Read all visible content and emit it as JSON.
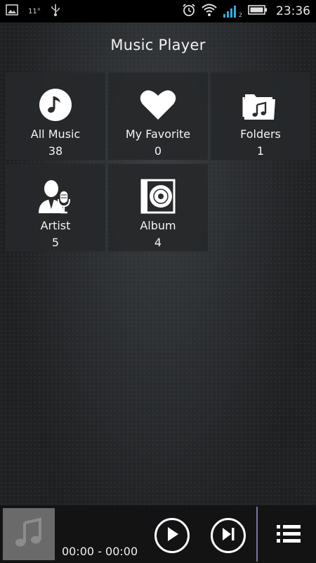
{
  "status_bar": {
    "temperature": "11°",
    "time": "23:36",
    "signal_tag": "2",
    "icons": [
      "gallery-icon",
      "usb-icon",
      "alarm-icon",
      "wifi-icon",
      "signal-icon",
      "battery-icon"
    ]
  },
  "header": {
    "title": "Music Player"
  },
  "tiles": [
    {
      "label": "All Music",
      "count": "38",
      "icon": "music-note-icon"
    },
    {
      "label": "My Favorite",
      "count": "0",
      "icon": "heart-icon"
    },
    {
      "label": "Folders",
      "count": "1",
      "icon": "folder-music-icon"
    },
    {
      "label": "Artist",
      "count": "5",
      "icon": "artist-microphone-icon"
    },
    {
      "label": "Album",
      "count": "4",
      "icon": "album-disc-icon"
    }
  ],
  "player": {
    "time_display": "00:00 - 00:00",
    "icons": [
      "album-art-placeholder-icon",
      "play-icon",
      "next-track-icon",
      "playlist-icon"
    ]
  },
  "colors": {
    "background": "#1e2022",
    "tile": "#26282a",
    "accent_divider": "#7f6fa8",
    "text": "#ffffff"
  }
}
